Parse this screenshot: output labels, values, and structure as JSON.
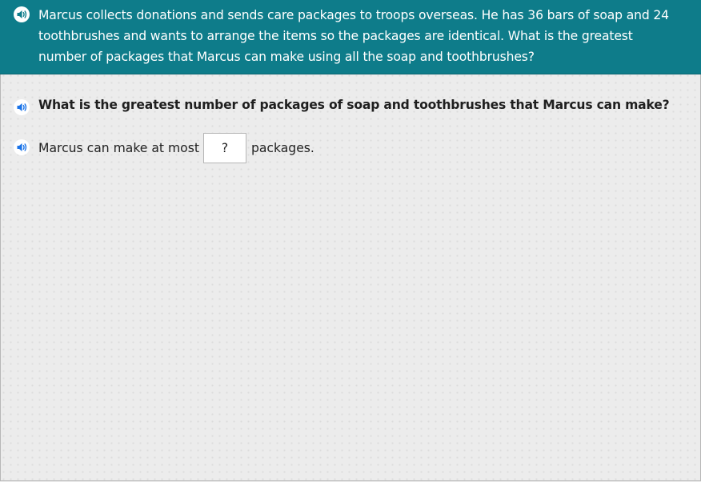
{
  "header": {
    "problem_text": "Marcus collects donations and sends care packages to troops overseas. He has 36 bars of soap and 24 toothbrushes and wants to arrange the items so the packages are identical. What is the greatest number of packages that Marcus can make using all the soap and toothbrushes?",
    "speaker_icon": "speaker-icon"
  },
  "question": {
    "text": "What is the greatest number of packages of soap and toothbrushes that Marcus can make?",
    "speaker_icon": "speaker-icon"
  },
  "answer": {
    "prefix": "Marcus can make at most",
    "placeholder": "?",
    "suffix": "packages.",
    "speaker_icon": "speaker-icon"
  },
  "colors": {
    "header_bg": "#0e7c8a",
    "page_bg": "#ececec",
    "speaker_blue": "#1a73e8"
  }
}
